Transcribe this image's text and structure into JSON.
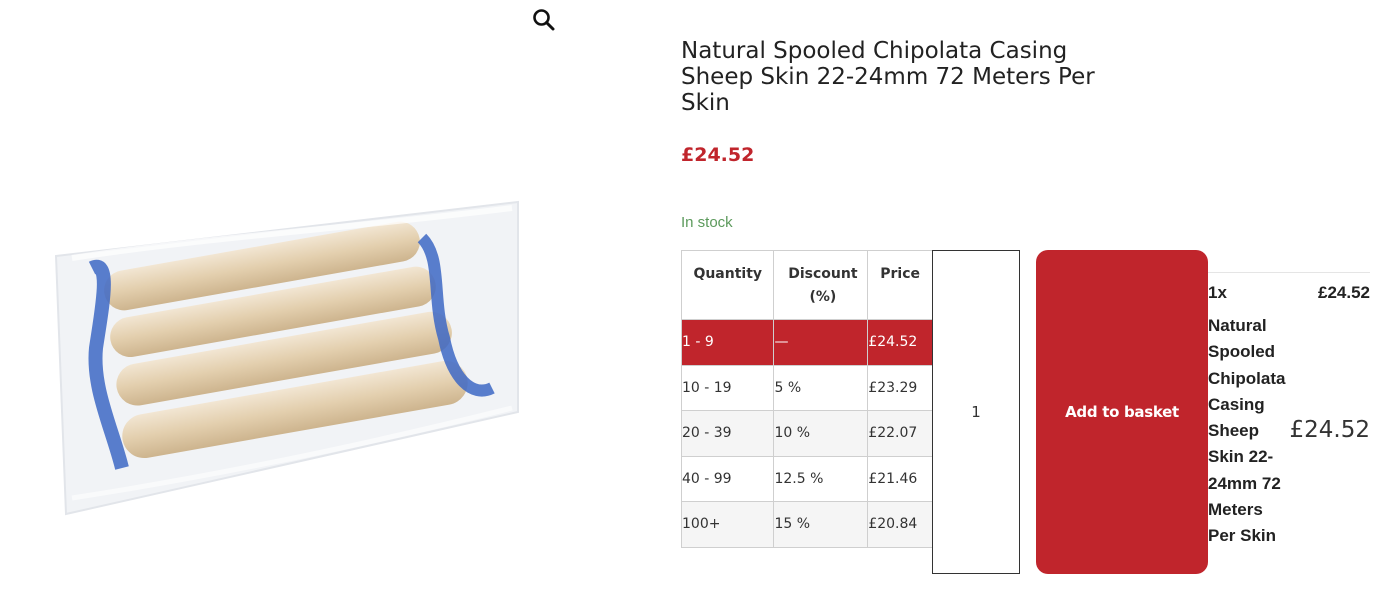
{
  "product": {
    "title": "Natural Spooled Chipolata Casing Sheep Skin 22-24mm 72 Meters Per Skin",
    "price": "£24.52",
    "stock_status": "In stock"
  },
  "discount_table": {
    "headers": [
      "Quantity",
      "Discount (%)",
      "Price"
    ],
    "rows": [
      {
        "quantity": "1 - 9",
        "discount": "—",
        "price": "£24.52",
        "active": true
      },
      {
        "quantity": "10 - 19",
        "discount": "5 %",
        "price": "£23.29"
      },
      {
        "quantity": "20 - 39",
        "discount": "10 %",
        "price": "£22.07"
      },
      {
        "quantity": "40 - 99",
        "discount": "12.5 %",
        "price": "£21.46"
      },
      {
        "quantity": "100+",
        "discount": "15 %",
        "price": "£20.84"
      }
    ]
  },
  "cart": {
    "quantity_value": "1",
    "add_to_basket_label": "Add to basket"
  },
  "summary": {
    "quantity_label": "1x",
    "unit_price": "£24.52",
    "product_name": "Natural Spooled Chipolata Casing Sheep Skin 22-24mm 72 Meters Per Skin",
    "total_price": "£24.52"
  },
  "icons": {
    "zoom": "magnifier-icon"
  },
  "colors": {
    "accent": "#c0252c",
    "stock": "#5c9a5c"
  }
}
